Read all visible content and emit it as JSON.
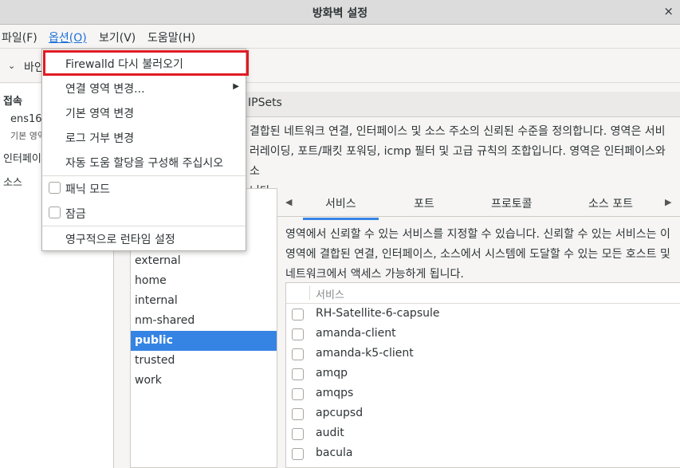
{
  "window": {
    "title": "방화벽 설정",
    "close_glyph": "×"
  },
  "menubar": {
    "items": [
      "파일(F)",
      "옵션(O)",
      "보기(V)",
      "도움말(H)"
    ]
  },
  "bind_row": {
    "chevron": "⌄",
    "label": "바인"
  },
  "left_panel": {
    "connections_label": "접속",
    "conn_name": "ens16",
    "conn_sub": "기본 영역",
    "interfaces_label": "인터페이",
    "sources_label": "소스"
  },
  "top_tabs": {
    "ipsets": "IPSets"
  },
  "description": {
    "line1": "결합된 네트워크 연결, 인터페이스 및 소스 주소의 신뢰된 수준을 정의합니다. 영역은 서비",
    "line2": "러레이딩, 포트/패킷 포워딩, icmp 필터 및 고급 규칙의 조합입니다. 영역은 인터페이스와 소",
    "line3": "니다."
  },
  "zones": [
    "external",
    "home",
    "internal",
    "nm-shared",
    "public",
    "trusted",
    "work"
  ],
  "selected_zone": "public",
  "subtabs": {
    "left_arrow": "◀",
    "right_arrow": "▶",
    "items": [
      "서비스",
      "포트",
      "프로토콜",
      "소스 포트"
    ]
  },
  "services_desc": {
    "line1": "영역에서 신뢰할 수 있는 서비스를 지정할 수 있습니다. 신뢰할 수 있는 서비스는 이",
    "line2": "영역에 결합된 연결, 인터페이스, 소스에서 시스템에 도달할 수 있는 모든 호스트 및",
    "line3": "네트워크에서 액세스 가능하게 됩니다."
  },
  "services_table": {
    "header": "서비스",
    "rows": [
      "RH-Satellite-6-capsule",
      "amanda-client",
      "amanda-k5-client",
      "amqp",
      "amqps",
      "apcupsd",
      "audit",
      "bacula"
    ]
  },
  "options_menu": {
    "reload": "Firewalld 다시 불러오기",
    "change_conn_zone": "연결 영역 변경...",
    "submenu_arrow": "▶",
    "change_default_zone": "기본 영역 변경",
    "change_log_denied": "로그 거부 변경",
    "auto_helpers": "자동 도움 할당을 구성해 주십시오",
    "panic_mode": "패닉 모드",
    "lockdown": "잠금",
    "runtime_to_permanent": "영구적으로 런타임 설정"
  },
  "colors": {
    "accent": "#3584e4",
    "highlight_border": "#e01b24"
  }
}
